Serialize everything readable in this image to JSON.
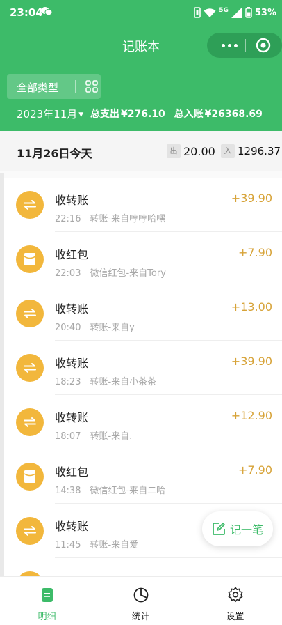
{
  "status_bar": {
    "time": "23:04",
    "network": "5G",
    "battery": "53%"
  },
  "app": {
    "title": "记账本"
  },
  "filters": {
    "type_label": "全部类型",
    "month": "2023年11月"
  },
  "summary": {
    "expense_label": "总支出",
    "expense_value": "¥276.10",
    "income_label": "总入账",
    "income_value": "¥26368.69"
  },
  "day": {
    "title": "11月26日今天",
    "out_tag": "出",
    "out_amount": "20.00",
    "in_tag": "入",
    "in_amount": "1296.37"
  },
  "transactions": [
    {
      "title": "收转账",
      "time": "22:16",
      "desc": "转账-来自哼哼哈嘿",
      "amount": "+39.90",
      "icon": "transfer-icon"
    },
    {
      "title": "收红包",
      "time": "22:03",
      "desc": "微信红包-来自Tory",
      "amount": "+7.90",
      "icon": "red-packet-icon"
    },
    {
      "title": "收转账",
      "time": "20:40",
      "desc": "转账-来自y",
      "amount": "+13.00",
      "icon": "transfer-icon"
    },
    {
      "title": "收转账",
      "time": "18:23",
      "desc": "转账-来自小茶茶",
      "amount": "+39.90",
      "icon": "transfer-icon"
    },
    {
      "title": "收转账",
      "time": "18:07",
      "desc": "转账-来自.",
      "amount": "+12.90",
      "icon": "transfer-icon"
    },
    {
      "title": "收红包",
      "time": "14:38",
      "desc": "微信红包-来自二哈",
      "amount": "+7.90",
      "icon": "red-packet-icon"
    },
    {
      "title": "收转账",
      "time": "11:45",
      "desc": "转账-来自爱",
      "amount": "",
      "icon": "transfer-icon"
    }
  ],
  "fab": {
    "label": "记一笔"
  },
  "tabs": [
    {
      "label": "明细",
      "icon": "list-icon",
      "active": true
    },
    {
      "label": "统计",
      "icon": "pie-chart-icon",
      "active": false
    },
    {
      "label": "设置",
      "icon": "gear-icon",
      "active": false
    }
  ],
  "colors": {
    "brand": "#3dbb69",
    "accent_amount": "#d7a338",
    "icon_bg": "#f2b73c"
  }
}
